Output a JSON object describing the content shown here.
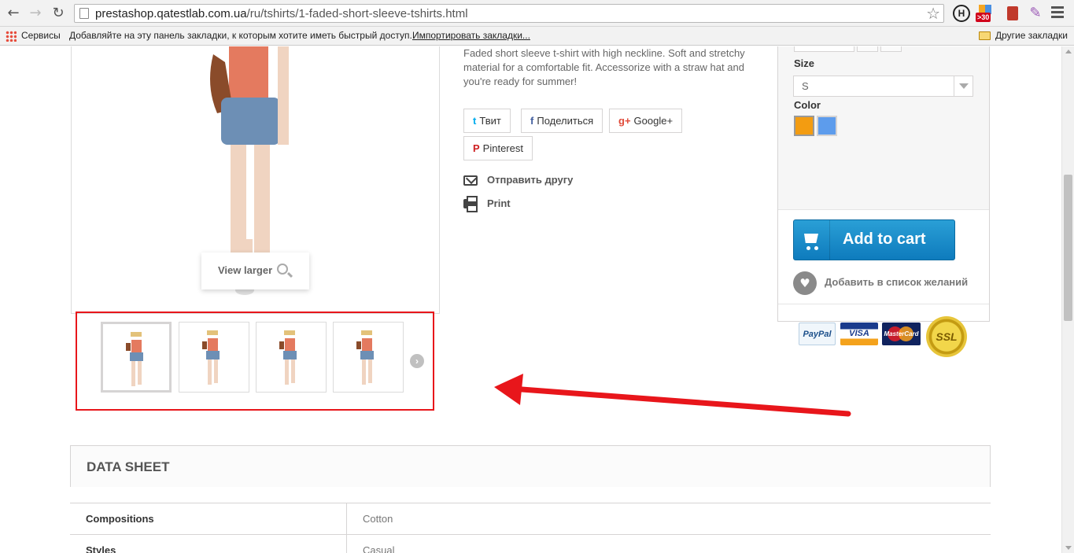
{
  "browser": {
    "url_prefix": "prestashop.qatestlab.com.ua",
    "url_path": "/ru/tshirts/1-faded-short-sleeve-tshirts.html",
    "ext_badge": ">30",
    "ext_h": "H"
  },
  "bookmarks": {
    "apps": "Сервисы",
    "hint": "Добавляйте на эту панель закладки, к которым хотите иметь быстрый доступ.",
    "import": "Импортировать закладки...",
    "other": "Другие закладки"
  },
  "product": {
    "description": "Faded short sleeve t-shirt with high neckline. Soft and stretchy material for a comfortable fit. Accessorize with a straw hat and you're ready for summer!",
    "view_larger": "View larger",
    "thumb_next": "›"
  },
  "social": {
    "twitter": "Твит",
    "twitter_icon": "t",
    "facebook": "Поделиться",
    "facebook_icon": "f",
    "google": "Google+",
    "google_icon": "g+",
    "pinterest": "Pinterest",
    "pinterest_icon": "P"
  },
  "links": {
    "send_friend": "Отправить другу",
    "print": "Print"
  },
  "buy_box": {
    "size_label": "Size",
    "size_value": "S",
    "color_label": "Color",
    "colors": [
      "#f39c11",
      "#5d9cec"
    ],
    "add_to_cart": "Add to cart",
    "wishlist": "Добавить в список желаний",
    "wishlist_icon": "♥",
    "payments": {
      "paypal": "PayPal",
      "visa": "VISA",
      "mastercard": "MasterCard",
      "ssl": "SSL"
    }
  },
  "datasheet": {
    "title": "DATA SHEET",
    "rows": [
      {
        "key": "Compositions",
        "value": "Cotton"
      },
      {
        "key": "Styles",
        "value": "Casual"
      }
    ]
  },
  "colors": {
    "annotation_red": "#e8161b",
    "cart_blue": "#1a8fd0"
  }
}
